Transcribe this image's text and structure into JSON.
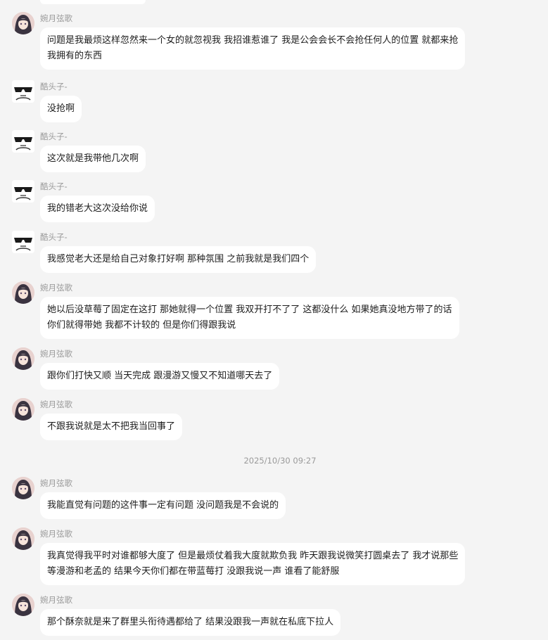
{
  "chat": {
    "timestamp": "2025/10/30 09:27",
    "messages": [
      {
        "sender": "婉月弦歌",
        "avatar": "girl-avatar",
        "lines": [
          "问题是我最烦这样忽然来一个女的就忽视我 我招谁惹谁了 我是公会会长不会抢任何人的位置 就都来抢",
          "我拥有的东西"
        ]
      },
      {
        "sender": "酷头子-",
        "avatar": "sunglasses-avatar",
        "lines": [
          "没抢啊"
        ]
      },
      {
        "sender": "酷头子-",
        "avatar": "sunglasses-avatar",
        "lines": [
          "这次就是我带他几次啊"
        ]
      },
      {
        "sender": "酷头子-",
        "avatar": "sunglasses-avatar",
        "lines": [
          "我的错老大这次没给你说"
        ]
      },
      {
        "sender": "酷头子-",
        "avatar": "sunglasses-avatar",
        "lines": [
          "我感觉老大还是给自己对象打好啊 那种氛围 之前我就是我们四个"
        ]
      },
      {
        "sender": "婉月弦歌",
        "avatar": "girl-avatar",
        "lines": [
          "她以后没草莓了固定在这打 那她就得一个位置 我双开打不了了 这都没什么 如果她真没地方带了的话",
          "你们就得带她 我都不计较的 但是你们得跟我说"
        ]
      },
      {
        "sender": "婉月弦歌",
        "avatar": "girl-avatar",
        "lines": [
          "跟你们打快又顺 当天完成 跟漫游又慢又不知道哪天去了"
        ]
      },
      {
        "sender": "婉月弦歌",
        "avatar": "girl-avatar",
        "lines": [
          "不跟我说就是太不把我当回事了"
        ]
      },
      {
        "sender": "婉月弦歌",
        "avatar": "girl-avatar",
        "lines": [
          "我能直觉有问题的这件事一定有问题 没问题我是不会说的"
        ]
      },
      {
        "sender": "婉月弦歌",
        "avatar": "girl-avatar",
        "lines": [
          "我真觉得我平时对谁都够大度了 但是最烦仗着我大度就欺负我 昨天跟我说微笑打圆桌去了 我才说那些",
          "等漫游和老孟的 结果今天你们都在带蓝莓打 没跟我说一声 谁看了能舒服"
        ]
      },
      {
        "sender": "婉月弦歌",
        "avatar": "girl-avatar",
        "lines": [
          "那个酥奈就是来了群里头衔待遇都给了 结果没跟我一声就在私底下拉人"
        ]
      }
    ]
  }
}
